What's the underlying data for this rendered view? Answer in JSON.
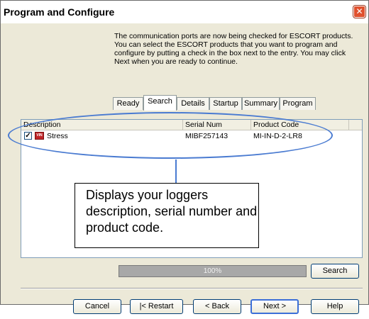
{
  "window": {
    "title": "Program and Configure",
    "close_glyph": "✕"
  },
  "intro_text": "The communication ports are now being checked for ESCORT products. You can select the ESCORT products that you want to program and configure by putting a check in the box next to the entry. You may click Next when you are ready to continue.",
  "tabs": [
    {
      "label": "Ready",
      "active": false
    },
    {
      "label": "Search",
      "active": true
    },
    {
      "label": "Details",
      "active": false
    },
    {
      "label": "Startup",
      "active": false
    },
    {
      "label": "Summary",
      "active": false
    },
    {
      "label": "Program",
      "active": false
    }
  ],
  "list": {
    "columns": [
      "Description",
      "Serial Num",
      "Product Code"
    ],
    "rows": [
      {
        "checked": true,
        "icon": "vin-logger-icon",
        "icon_text": "VIN",
        "description": "Stress",
        "serial": "MIBF257143",
        "product_code": "MI-IN-D-2-LR8"
      }
    ]
  },
  "callout_text": "Displays your loggers description, serial number and product code.",
  "progress": {
    "percent": 100,
    "label": "100%"
  },
  "buttons": {
    "search": "Search",
    "cancel": "Cancel",
    "restart": "|< Restart",
    "back": "< Back",
    "next": "Next >",
    "help": "Help"
  },
  "colors": {
    "accent": "#4a7bd1",
    "close_button": "#e0512e",
    "window_bg": "#ece9d8"
  }
}
